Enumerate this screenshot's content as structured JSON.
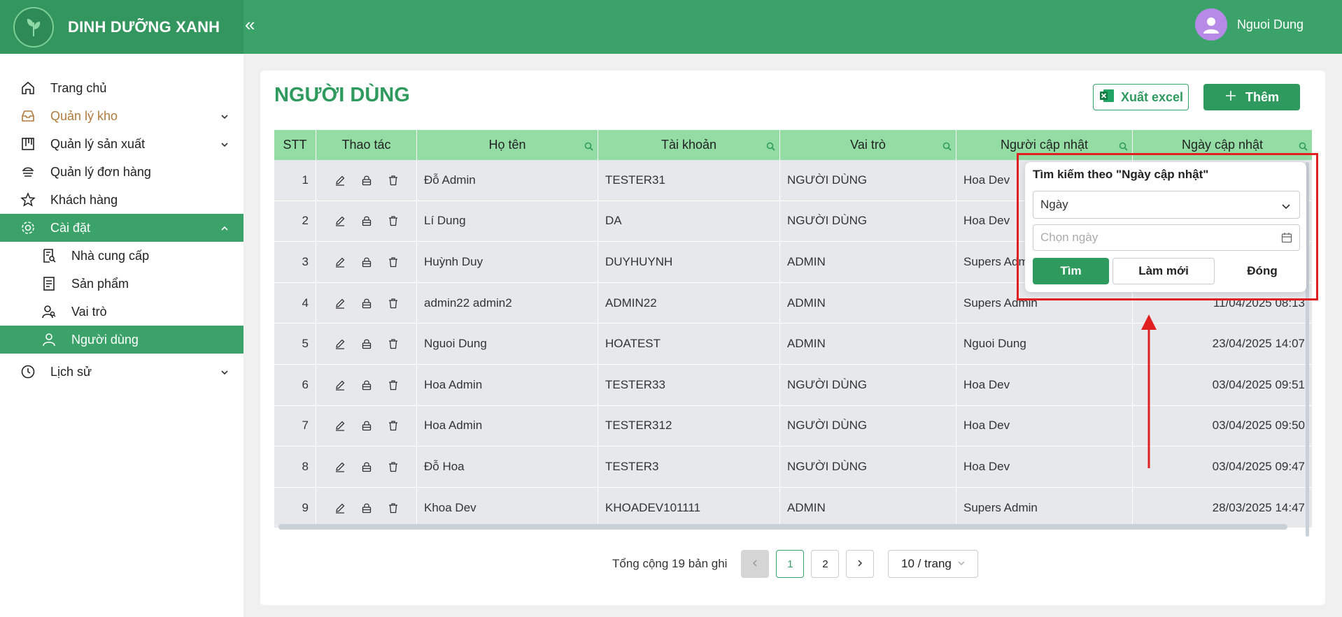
{
  "header": {
    "brand": "DINH DƯỠNG XANH",
    "collapse": "«",
    "user_name": "Nguoi Dung"
  },
  "sidebar": {
    "items": [
      {
        "label": "Trang chủ",
        "icon": "home-icon"
      },
      {
        "label": "Quản lý kho",
        "icon": "inbox-icon"
      },
      {
        "label": "Quản lý sản xuất",
        "icon": "board-icon"
      },
      {
        "label": "Quản lý đơn hàng",
        "icon": "orders-icon"
      },
      {
        "label": "Khách hàng",
        "icon": "star-icon"
      },
      {
        "label": "Cài đặt",
        "icon": "gear-icon"
      },
      {
        "label": "Nhà cung cấp",
        "icon": "supplier-icon"
      },
      {
        "label": "Sản phẩm",
        "icon": "product-icon"
      },
      {
        "label": "Vai trò",
        "icon": "role-icon"
      },
      {
        "label": "Người dùng",
        "icon": "user-icon"
      },
      {
        "label": "Lịch sử",
        "icon": "history-icon"
      }
    ]
  },
  "page": {
    "title": "NGƯỜI DÙNG",
    "excel_label": "Xuất excel",
    "add_label": "Thêm"
  },
  "table": {
    "headers": [
      "STT",
      "Thao tác",
      "Họ tên",
      "Tài khoản",
      "Vai trò",
      "Người cập nhật",
      "Ngày cập nhật"
    ],
    "rows": [
      [
        "1",
        "Đỗ Admin",
        "TESTER31",
        "NGƯỜI DÙNG",
        "Hoa Dev",
        ""
      ],
      [
        "2",
        "Lí Dung",
        "DA",
        "NGƯỜI DÙNG",
        "Hoa Dev",
        ""
      ],
      [
        "3",
        "Huỳnh Duy",
        "DUYHUYNH",
        "ADMIN",
        "Supers Admin",
        ""
      ],
      [
        "4",
        "admin22 admin2",
        "ADMIN22",
        "ADMIN",
        "Supers Admin",
        "11/04/2025 08:13"
      ],
      [
        "5",
        "Nguoi Dung",
        "HOATEST",
        "ADMIN",
        "Nguoi Dung",
        "23/04/2025 14:07"
      ],
      [
        "6",
        "Hoa Admin",
        "TESTER33",
        "NGƯỜI DÙNG",
        "Hoa Dev",
        "03/04/2025 09:51"
      ],
      [
        "7",
        "Hoa Admin",
        "TESTER312",
        "NGƯỜI DÙNG",
        "Hoa Dev",
        "03/04/2025 09:50"
      ],
      [
        "8",
        "Đỗ Hoa",
        "TESTER3",
        "NGƯỜI DÙNG",
        "Hoa Dev",
        "03/04/2025 09:47"
      ],
      [
        "9",
        "Khoa Dev",
        "KHOADEV101111",
        "ADMIN",
        "Supers Admin",
        "28/03/2025 14:47"
      ]
    ]
  },
  "pagination": {
    "total": "Tổng cộng 19 bản ghi",
    "prev": "<",
    "pages": [
      "1",
      "2"
    ],
    "next": ">",
    "page_size": "10 / trang"
  },
  "filter_popup": {
    "title": "Tìm kiếm theo \"Ngày cập nhật\"",
    "select_value": "Ngày",
    "date_placeholder": "Chọn ngày",
    "find_label": "Tìm",
    "reset_label": "Làm mới",
    "close_label": "Đóng"
  },
  "colors": {
    "primary": "#3ba36a",
    "header_bg": "#93dda4",
    "highlight": "#e02020"
  }
}
